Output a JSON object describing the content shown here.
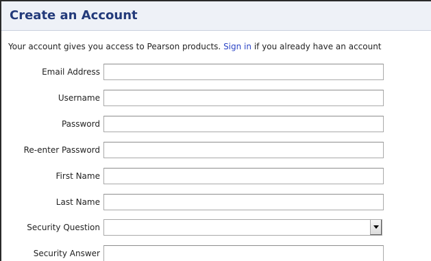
{
  "form": {
    "title": "Create an Account",
    "intro_prefix": "Your account gives you access to Pearson products. ",
    "sign_in_link": "Sign in",
    "intro_suffix": " if you already have an account",
    "fields": [
      {
        "label": "Email Address",
        "value": ""
      },
      {
        "label": "Username",
        "value": ""
      },
      {
        "label": "Password",
        "value": ""
      },
      {
        "label": "Re-enter Password",
        "value": ""
      },
      {
        "label": "First Name",
        "value": ""
      },
      {
        "label": "Last Name",
        "value": ""
      },
      {
        "label": "Security Question",
        "value": ""
      },
      {
        "label": "Security Answer",
        "value": ""
      }
    ]
  },
  "icons": {
    "dropdown": "chevron-down-icon"
  },
  "colors": {
    "title": "#233a7a",
    "link": "#2b44c6",
    "title_bar_bg": "#eef1f7"
  }
}
